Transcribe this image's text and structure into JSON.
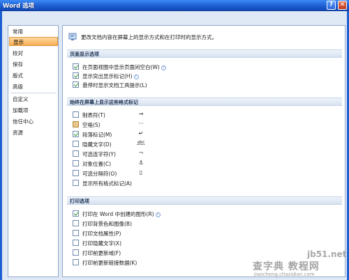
{
  "window": {
    "title": "Word 选项",
    "help_label": "?",
    "close_label": "✕"
  },
  "sidebar": {
    "items": [
      {
        "label": "常用"
      },
      {
        "label": "显示"
      },
      {
        "label": "校对"
      },
      {
        "label": "保存"
      },
      {
        "label": "版式"
      },
      {
        "label": "高级"
      },
      {
        "label": "自定义"
      },
      {
        "label": "加载项"
      },
      {
        "label": "信任中心"
      },
      {
        "label": "资源"
      }
    ],
    "active_index": 1
  },
  "content": {
    "header": "更改文档内容在屏幕上的显示方式和在打印时的显示方式。",
    "page_section": {
      "title": "页面显示选项",
      "options": [
        {
          "label": "在页面视图中显示页面间空白(W)",
          "checked": true,
          "info": true
        },
        {
          "label": "显示突出显示标记(H)",
          "checked": true,
          "info": true
        },
        {
          "label": "悬停时显示文档工具提示(L)",
          "checked": true,
          "info": false
        }
      ]
    },
    "format_section": {
      "title": "始终在屏幕上显示这些格式标记",
      "options": [
        {
          "label": "制表符(T)",
          "checked": false,
          "mark": "→"
        },
        {
          "label": "空格(S)",
          "checked": false,
          "mark": "···",
          "tinted": true
        },
        {
          "label": "段落标记(M)",
          "checked": true,
          "mark": "↵"
        },
        {
          "label": "隐藏文字(D)",
          "checked": false,
          "mark": "abc"
        },
        {
          "label": "可选连字符(Y)",
          "checked": false,
          "mark": "¬"
        },
        {
          "label": "对象位置(C)",
          "checked": false,
          "mark": "⚓"
        },
        {
          "label": "可选分隔符(O)",
          "checked": false,
          "mark": "▯"
        },
        {
          "label": "显示所有格式标记(A)",
          "checked": false,
          "mark": ""
        }
      ]
    },
    "print_section": {
      "title": "打印选项",
      "options": [
        {
          "label": "打印在 Word 中创建的图形(R)",
          "checked": true,
          "info": true
        },
        {
          "label": "打印背景色和图像(B)",
          "checked": false,
          "info": false
        },
        {
          "label": "打印文档属性(P)",
          "checked": false,
          "info": false
        },
        {
          "label": "打印隐藏文字(X)",
          "checked": false,
          "info": false
        },
        {
          "label": "打印前更新域(F)",
          "checked": false,
          "info": false
        },
        {
          "label": "打印前更新链接数据(K)",
          "checked": false,
          "info": false
        }
      ]
    }
  },
  "watermark": {
    "brand": "jb51.net",
    "cn": "查字典 教程网",
    "url": "jiaocheng.chazidian.com"
  },
  "colors": {
    "title_bar": "#1d5fd3",
    "frame": "#dfe9f5",
    "active_nav": "#f6ad52",
    "section_bar": "#d7e2f1"
  }
}
